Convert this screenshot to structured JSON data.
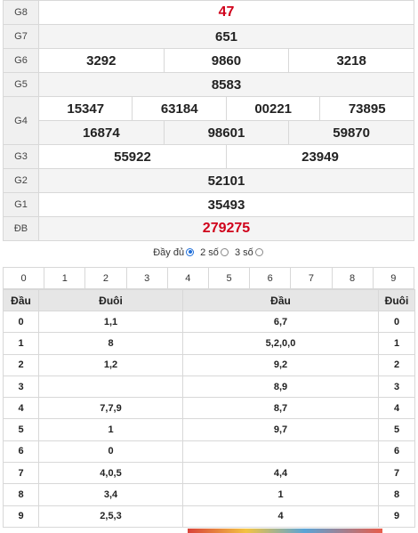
{
  "results": {
    "g8": {
      "label": "G8",
      "values": [
        "47"
      ]
    },
    "g7": {
      "label": "G7",
      "values": [
        "651"
      ]
    },
    "g6": {
      "label": "G6",
      "values": [
        "3292",
        "9860",
        "3218"
      ]
    },
    "g5": {
      "label": "G5",
      "values": [
        "8583"
      ]
    },
    "g4": {
      "label": "G4",
      "values": [
        "15347",
        "63184",
        "00221",
        "73895",
        "16874",
        "98601",
        "59870"
      ]
    },
    "g3": {
      "label": "G3",
      "values": [
        "55922",
        "23949"
      ]
    },
    "g2": {
      "label": "G2",
      "values": [
        "52101"
      ]
    },
    "g1": {
      "label": "G1",
      "values": [
        "35493"
      ]
    },
    "db": {
      "label": "ĐB",
      "values": [
        "279275"
      ]
    }
  },
  "filter": {
    "full_label": "Đầy đủ",
    "two_label": "2 số",
    "three_label": "3 số",
    "selected": "2 số"
  },
  "digit_row": [
    "0",
    "1",
    "2",
    "3",
    "4",
    "5",
    "6",
    "7",
    "8",
    "9"
  ],
  "loto": {
    "headers": {
      "dau_left": "Đầu",
      "duoi_left": "Đuôi",
      "dau_right": "Đầu",
      "duoi_right": "Đuôi"
    },
    "rows": [
      {
        "d": "0",
        "left": "1,1",
        "right": "6,7",
        "r": "0"
      },
      {
        "d": "1",
        "left": "8",
        "right": "5,2,0,0",
        "r": "1"
      },
      {
        "d": "2",
        "left": "1,2",
        "right": "9,2",
        "r": "2"
      },
      {
        "d": "3",
        "left": "",
        "right": "8,9",
        "r": "3"
      },
      {
        "d": "4",
        "left": "7,7,9",
        "right": "8,7",
        "r": "4"
      },
      {
        "d": "5",
        "left": "1",
        "right": "9,7",
        "r": "5"
      },
      {
        "d": "6",
        "left": "0",
        "right": "",
        "r": "6"
      },
      {
        "d": "7",
        "left": "4,0,5",
        "right": "4,4",
        "r": "7"
      },
      {
        "d": "8",
        "left": "3,4",
        "right": "1",
        "r": "8"
      },
      {
        "d": "9",
        "left": "2,5,3",
        "right": "4",
        "r": "9"
      }
    ]
  },
  "colors": {
    "accent_red": "#d0021b",
    "radio_blue": "#1e6ed9"
  }
}
